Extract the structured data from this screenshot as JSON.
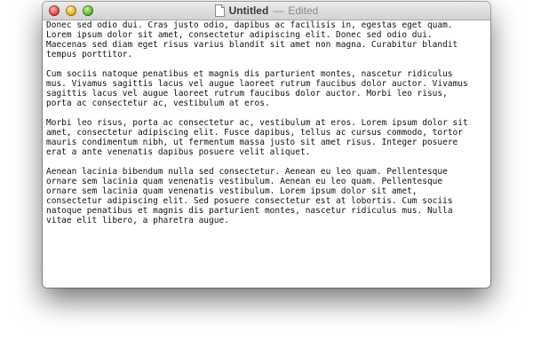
{
  "window": {
    "title": "Untitled",
    "separator": "—",
    "status": "Edited"
  },
  "icons": {
    "close": "close-light",
    "minimize": "minimize-light",
    "zoom": "zoom-light",
    "document": "document-icon"
  },
  "document": {
    "paragraphs": [
      "Donec sed odio dui. Cras justo odio, dapibus ac facilisis in, egestas eget quam.\nLorem ipsum dolor sit amet, consectetur adipiscing elit. Donec sed odio dui.\nMaecenas sed diam eget risus varius blandit sit amet non magna. Curabitur blandit\ntempus porttitor.",
      "Cum sociis natoque penatibus et magnis dis parturient montes, nascetur ridiculus\nmus. Vivamus sagittis lacus vel augue laoreet rutrum faucibus dolor auctor. Vivamus\nsagittis lacus vel augue laoreet rutrum faucibus dolor auctor. Morbi leo risus,\nporta ac consectetur ac, vestibulum at eros.",
      "Morbi leo risus, porta ac consectetur ac, vestibulum at eros. Lorem ipsum dolor sit\namet, consectetur adipiscing elit. Fusce dapibus, tellus ac cursus commodo, tortor\nmauris condimentum nibh, ut fermentum massa justo sit amet risus. Integer posuere\nerat a ante venenatis dapibus posuere velit aliquet.",
      "Aenean lacinia bibendum nulla sed consectetur. Aenean eu leo quam. Pellentesque\nornare sem lacinia quam venenatis vestibulum. Aenean eu leo quam. Pellentesque\nornare sem lacinia quam venenatis vestibulum. Lorem ipsum dolor sit amet,\nconsectetur adipiscing elit. Sed posuere consectetur est at lobortis. Cum sociis\nnatoque penatibus et magnis dis parturient montes, nascetur ridiculus mus. Nulla\nvitae elit libero, a pharetra augue."
    ]
  }
}
